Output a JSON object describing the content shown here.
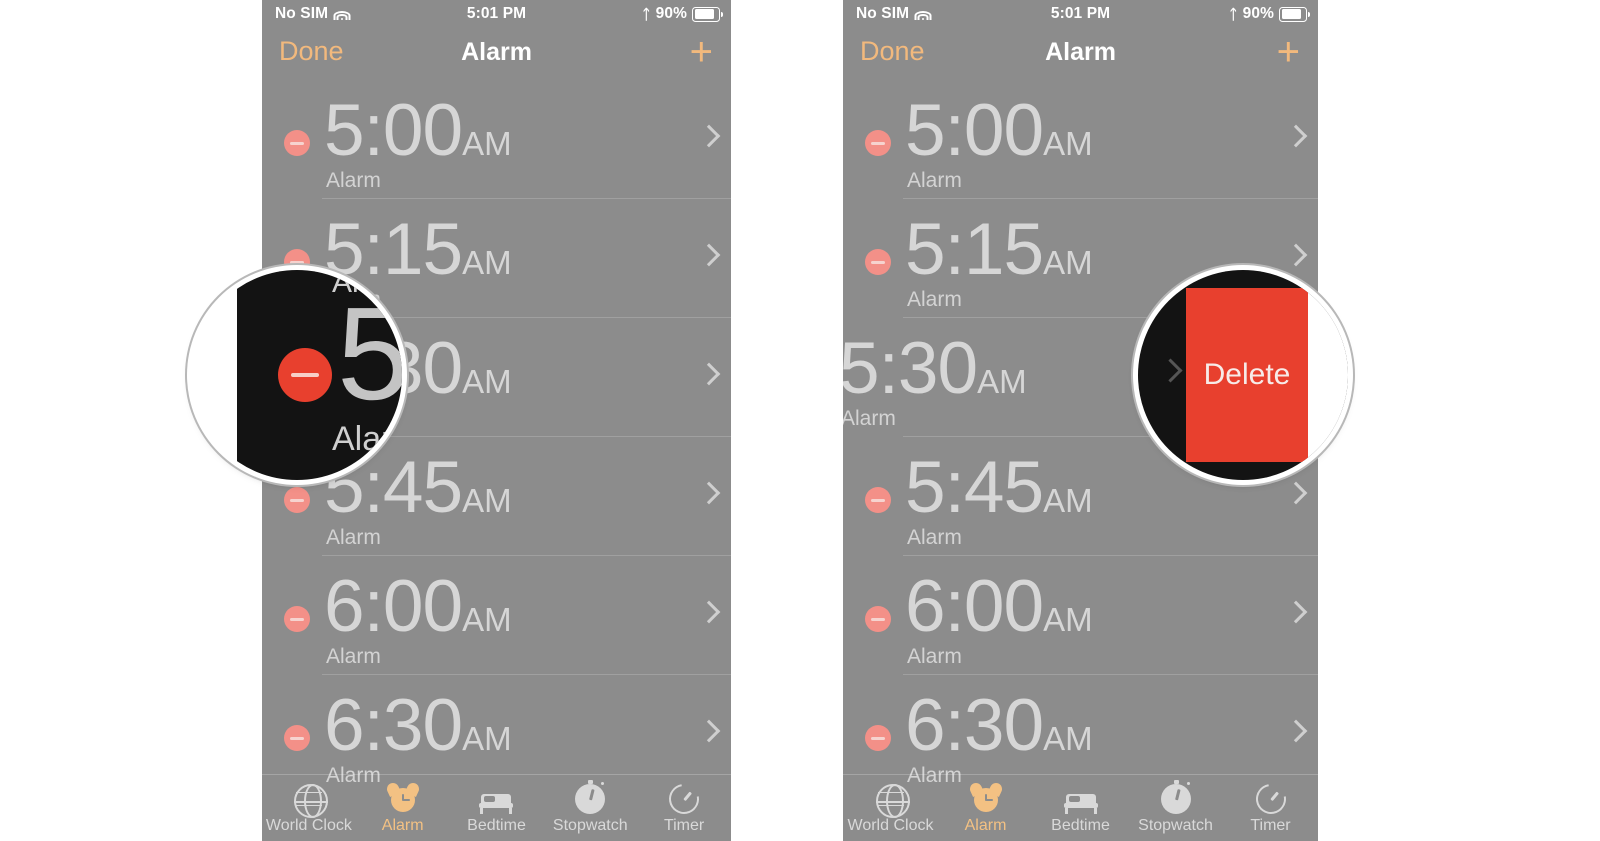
{
  "panels": [
    {
      "id": "left",
      "status_bar": {
        "carrier": "No SIM",
        "wifi_icon": "wifi-icon",
        "time": "5:01 PM",
        "bluetooth_icon": "bluetooth-icon",
        "battery_percent": "90%",
        "battery_icon": "battery-icon"
      },
      "nav": {
        "done_label": "Done",
        "title": "Alarm",
        "add_label": "+"
      },
      "alarms": [
        {
          "time": "5:00",
          "period": "AM",
          "label": "Alarm",
          "swiped": false
        },
        {
          "time": "5:15",
          "period": "AM",
          "label": "Alarm",
          "swiped": false
        },
        {
          "time": "5:30",
          "period": "AM",
          "label": "Alarm",
          "swiped": false
        },
        {
          "time": "5:45",
          "period": "AM",
          "label": "Alarm",
          "swiped": false
        },
        {
          "time": "6:00",
          "period": "AM",
          "label": "Alarm",
          "swiped": false
        },
        {
          "time": "6:30",
          "period": "AM",
          "label": "Alarm",
          "swiped": false
        }
      ],
      "tabs": [
        {
          "label": "World Clock",
          "icon": "globe-icon",
          "active": false
        },
        {
          "label": "Alarm",
          "icon": "alarm-clock-icon",
          "active": true
        },
        {
          "label": "Bedtime",
          "icon": "bed-icon",
          "active": false
        },
        {
          "label": "Stopwatch",
          "icon": "stopwatch-icon",
          "active": false
        },
        {
          "label": "Timer",
          "icon": "timer-icon",
          "active": false
        }
      ],
      "magnifier": {
        "type": "minus-button-callout",
        "digit": "5",
        "label": "Alarm",
        "label_top": "Alarm",
        "button_icon": "minus-circle-icon",
        "accent_color": "#e8402e"
      }
    },
    {
      "id": "right",
      "status_bar": {
        "carrier": "No SIM",
        "wifi_icon": "wifi-icon",
        "time": "5:01 PM",
        "bluetooth_icon": "bluetooth-icon",
        "battery_percent": "90%",
        "battery_icon": "battery-icon"
      },
      "nav": {
        "done_label": "Done",
        "title": "Alarm",
        "add_label": "+"
      },
      "alarms": [
        {
          "time": "5:00",
          "period": "AM",
          "label": "Alarm",
          "swiped": false
        },
        {
          "time": "5:15",
          "period": "AM",
          "label": "Alarm",
          "swiped": false
        },
        {
          "time": "5:30",
          "period": "AM",
          "label": "Alarm",
          "swiped": true
        },
        {
          "time": "5:45",
          "period": "AM",
          "label": "Alarm",
          "swiped": false
        },
        {
          "time": "6:00",
          "period": "AM",
          "label": "Alarm",
          "swiped": false
        },
        {
          "time": "6:30",
          "period": "AM",
          "label": "Alarm",
          "swiped": false
        }
      ],
      "tabs": [
        {
          "label": "World Clock",
          "icon": "globe-icon",
          "active": false
        },
        {
          "label": "Alarm",
          "icon": "alarm-clock-icon",
          "active": true
        },
        {
          "label": "Bedtime",
          "icon": "bed-icon",
          "active": false
        },
        {
          "label": "Stopwatch",
          "icon": "stopwatch-icon",
          "active": false
        },
        {
          "label": "Timer",
          "icon": "timer-icon",
          "active": false
        }
      ],
      "magnifier": {
        "type": "delete-button-callout",
        "delete_label": "Delete",
        "chevron_icon": "chevron-right-icon",
        "accent_color": "#e8402e"
      }
    }
  ],
  "colors": {
    "screen_dim": "#8c8c8c",
    "accent_orange": "#f2b97d",
    "tab_active": "#f3c183",
    "delete_red": "#e8402e",
    "minus_pink": "#f39088",
    "text_light": "#d6d6d6"
  }
}
